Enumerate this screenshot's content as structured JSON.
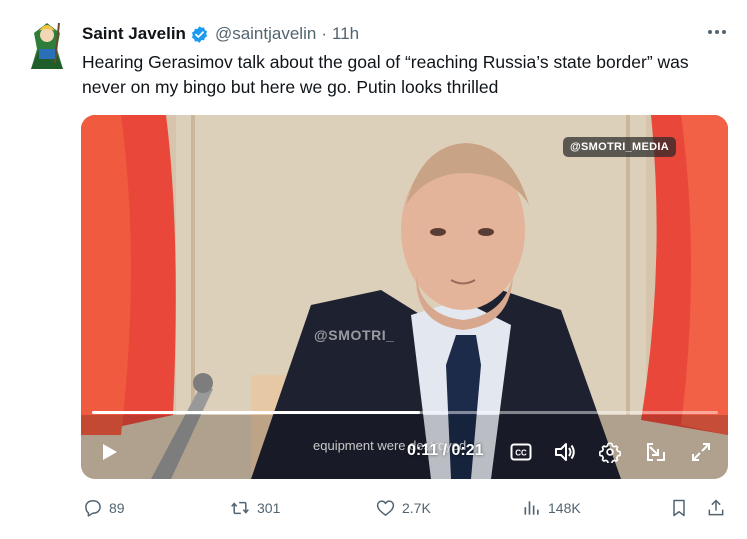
{
  "tweet": {
    "display_name": "Saint Javelin",
    "handle": "@saintjavelin",
    "separator": "·",
    "time": "11h",
    "text": "Hearing Gerasimov talk about the goal of “reaching Russia’s state border” was never on my bingo but here we go. Putin looks thrilled"
  },
  "media": {
    "watermark_top": "@SMOTRI_MEDIA",
    "watermark_mid": "@SMOTRI_",
    "subtitle": "equipment were destroyed",
    "time_display": "0:11 / 0:21",
    "progress": 0.524
  },
  "actions": {
    "replies": "89",
    "reposts": "301",
    "likes": "2.7K",
    "views": "148K"
  },
  "colors": {
    "verified": "#1d9bf0",
    "muted": "#536471",
    "flag_red": "#e8473a"
  }
}
